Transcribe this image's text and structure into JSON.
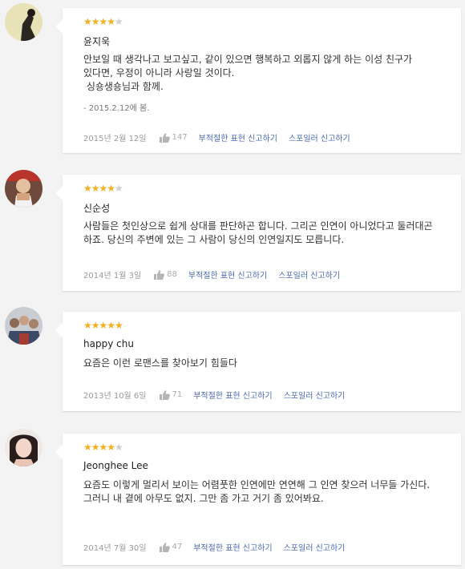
{
  "reviews": [
    {
      "rating": 4,
      "author": "윤지욱",
      "lines": [
        "안보일 때 생각나고 보고싶고, 같이 있으면 행복하고 외롭지 않게 하는 이성 친구가",
        "있다면, 우정이 아니라 사랑일 것이다.",
        " 싱숑생숑님과 함께."
      ],
      "note": "- 2015.2.12에 봄.",
      "date": "2015년 2월 12일",
      "likes": "147",
      "report_label": "부적절한 표현 신고하기",
      "spoiler_label": "스포일러 신고하기"
    },
    {
      "rating": 4,
      "author": "신순성",
      "text": "사람들은 첫인상으로 쉽게 상대를 판단하곤 합니다. 그리곤 인연이 아니었다고 둘러대곤 하죠. 당신의 주변에 있는 그 사람이 당신의 인연일지도 모릅니다.",
      "date": "2014년 1월 3일",
      "likes": "88",
      "report_label": "부적절한 표현 신고하기",
      "spoiler_label": "스포일러 신고하기"
    },
    {
      "rating": 5,
      "author": "happy chu",
      "lines": [
        "요즘은 이런 로맨스를 찾아보기 힘들다"
      ],
      "date": "2013년 10월 6일",
      "likes": "71",
      "report_label": "부적절한 표현 신고하기",
      "spoiler_label": "스포일러 신고하기"
    },
    {
      "rating": 4,
      "author": "Jeonghee Lee",
      "text": "요즘도 이렇게 멀리서 보이는 어렴풋한 인연에만 연연해 그 인연 찾으러 너무들 가신다.",
      "line2": "그러니 내 곁에 아무도 없지. 그만 좀 가고 거기 좀 있어봐요.",
      "date": "2014년 7월 30일",
      "likes": "47",
      "report_label": "부적절한 표현 신고하기",
      "spoiler_label": "스포일러 신고하기"
    }
  ],
  "colors": {
    "star_on": "#f2b01e",
    "star_off": "#cfcfcf",
    "link": "#4a69b3",
    "background": "#f3f3f3"
  },
  "icons": {
    "avatar": "user-photo",
    "star": "star-icon",
    "like": "thumbs-up-icon"
  }
}
